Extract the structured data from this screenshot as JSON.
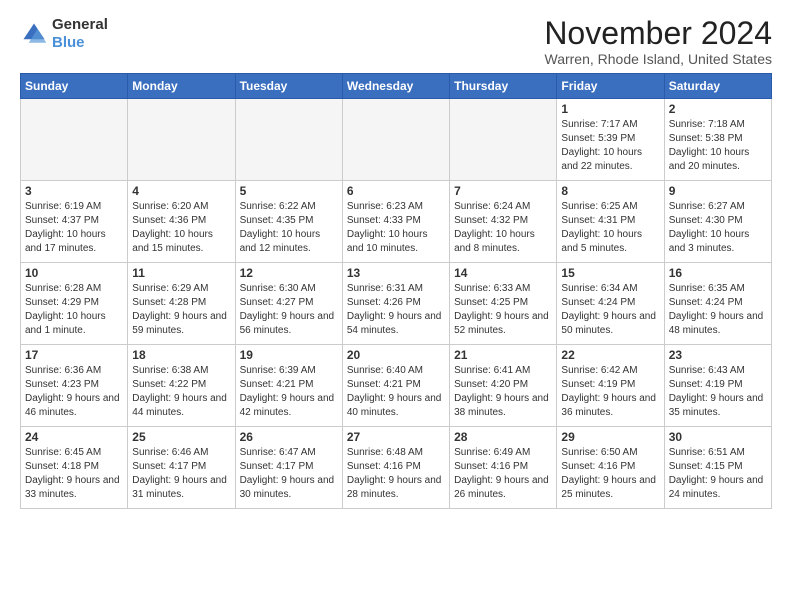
{
  "app": {
    "logo_line1": "General",
    "logo_line2": "Blue"
  },
  "header": {
    "month": "November 2024",
    "location": "Warren, Rhode Island, United States"
  },
  "weekdays": [
    "Sunday",
    "Monday",
    "Tuesday",
    "Wednesday",
    "Thursday",
    "Friday",
    "Saturday"
  ],
  "weeks": [
    [
      {
        "day": "",
        "info": ""
      },
      {
        "day": "",
        "info": ""
      },
      {
        "day": "",
        "info": ""
      },
      {
        "day": "",
        "info": ""
      },
      {
        "day": "",
        "info": ""
      },
      {
        "day": "1",
        "info": "Sunrise: 7:17 AM\nSunset: 5:39 PM\nDaylight: 10 hours and 22 minutes."
      },
      {
        "day": "2",
        "info": "Sunrise: 7:18 AM\nSunset: 5:38 PM\nDaylight: 10 hours and 20 minutes."
      }
    ],
    [
      {
        "day": "3",
        "info": "Sunrise: 6:19 AM\nSunset: 4:37 PM\nDaylight: 10 hours and 17 minutes."
      },
      {
        "day": "4",
        "info": "Sunrise: 6:20 AM\nSunset: 4:36 PM\nDaylight: 10 hours and 15 minutes."
      },
      {
        "day": "5",
        "info": "Sunrise: 6:22 AM\nSunset: 4:35 PM\nDaylight: 10 hours and 12 minutes."
      },
      {
        "day": "6",
        "info": "Sunrise: 6:23 AM\nSunset: 4:33 PM\nDaylight: 10 hours and 10 minutes."
      },
      {
        "day": "7",
        "info": "Sunrise: 6:24 AM\nSunset: 4:32 PM\nDaylight: 10 hours and 8 minutes."
      },
      {
        "day": "8",
        "info": "Sunrise: 6:25 AM\nSunset: 4:31 PM\nDaylight: 10 hours and 5 minutes."
      },
      {
        "day": "9",
        "info": "Sunrise: 6:27 AM\nSunset: 4:30 PM\nDaylight: 10 hours and 3 minutes."
      }
    ],
    [
      {
        "day": "10",
        "info": "Sunrise: 6:28 AM\nSunset: 4:29 PM\nDaylight: 10 hours and 1 minute."
      },
      {
        "day": "11",
        "info": "Sunrise: 6:29 AM\nSunset: 4:28 PM\nDaylight: 9 hours and 59 minutes."
      },
      {
        "day": "12",
        "info": "Sunrise: 6:30 AM\nSunset: 4:27 PM\nDaylight: 9 hours and 56 minutes."
      },
      {
        "day": "13",
        "info": "Sunrise: 6:31 AM\nSunset: 4:26 PM\nDaylight: 9 hours and 54 minutes."
      },
      {
        "day": "14",
        "info": "Sunrise: 6:33 AM\nSunset: 4:25 PM\nDaylight: 9 hours and 52 minutes."
      },
      {
        "day": "15",
        "info": "Sunrise: 6:34 AM\nSunset: 4:24 PM\nDaylight: 9 hours and 50 minutes."
      },
      {
        "day": "16",
        "info": "Sunrise: 6:35 AM\nSunset: 4:24 PM\nDaylight: 9 hours and 48 minutes."
      }
    ],
    [
      {
        "day": "17",
        "info": "Sunrise: 6:36 AM\nSunset: 4:23 PM\nDaylight: 9 hours and 46 minutes."
      },
      {
        "day": "18",
        "info": "Sunrise: 6:38 AM\nSunset: 4:22 PM\nDaylight: 9 hours and 44 minutes."
      },
      {
        "day": "19",
        "info": "Sunrise: 6:39 AM\nSunset: 4:21 PM\nDaylight: 9 hours and 42 minutes."
      },
      {
        "day": "20",
        "info": "Sunrise: 6:40 AM\nSunset: 4:21 PM\nDaylight: 9 hours and 40 minutes."
      },
      {
        "day": "21",
        "info": "Sunrise: 6:41 AM\nSunset: 4:20 PM\nDaylight: 9 hours and 38 minutes."
      },
      {
        "day": "22",
        "info": "Sunrise: 6:42 AM\nSunset: 4:19 PM\nDaylight: 9 hours and 36 minutes."
      },
      {
        "day": "23",
        "info": "Sunrise: 6:43 AM\nSunset: 4:19 PM\nDaylight: 9 hours and 35 minutes."
      }
    ],
    [
      {
        "day": "24",
        "info": "Sunrise: 6:45 AM\nSunset: 4:18 PM\nDaylight: 9 hours and 33 minutes."
      },
      {
        "day": "25",
        "info": "Sunrise: 6:46 AM\nSunset: 4:17 PM\nDaylight: 9 hours and 31 minutes."
      },
      {
        "day": "26",
        "info": "Sunrise: 6:47 AM\nSunset: 4:17 PM\nDaylight: 9 hours and 30 minutes."
      },
      {
        "day": "27",
        "info": "Sunrise: 6:48 AM\nSunset: 4:16 PM\nDaylight: 9 hours and 28 minutes."
      },
      {
        "day": "28",
        "info": "Sunrise: 6:49 AM\nSunset: 4:16 PM\nDaylight: 9 hours and 26 minutes."
      },
      {
        "day": "29",
        "info": "Sunrise: 6:50 AM\nSunset: 4:16 PM\nDaylight: 9 hours and 25 minutes."
      },
      {
        "day": "30",
        "info": "Sunrise: 6:51 AM\nSunset: 4:15 PM\nDaylight: 9 hours and 24 minutes."
      }
    ]
  ]
}
